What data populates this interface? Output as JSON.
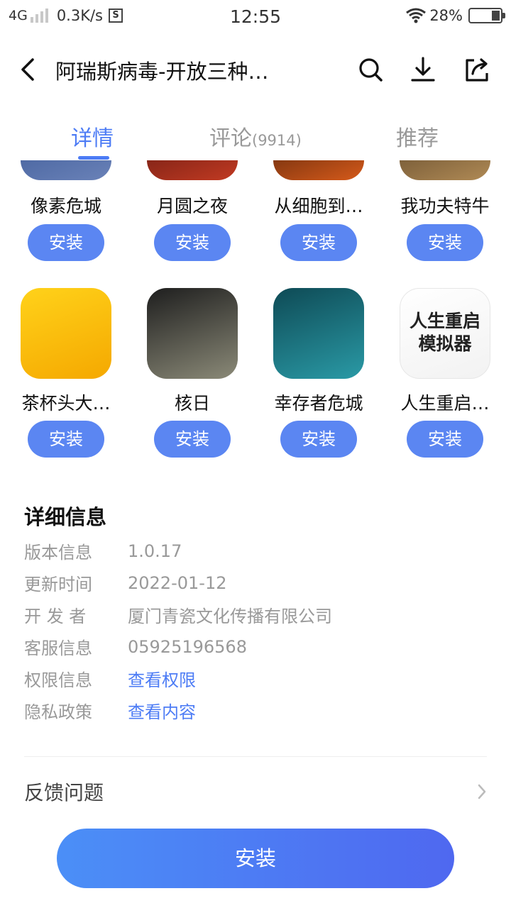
{
  "status_bar": {
    "network": "4G",
    "speed": "0.3K/s",
    "s_badge": "S",
    "time": "12:55",
    "battery": "28%",
    "battery_level": 0.28
  },
  "header": {
    "back_icon": "back-arrow-icon",
    "title": "阿瑞斯病毒-开放三种…",
    "actions": [
      "search-icon",
      "download-icon",
      "share-icon"
    ]
  },
  "tabs": [
    {
      "label": "详情",
      "count": ""
    },
    {
      "label": "评论",
      "count": "(9914)"
    },
    {
      "label": "推荐",
      "count": ""
    }
  ],
  "recommend": {
    "install_label": "安装",
    "rows": [
      [
        {
          "name": "像素危城",
          "colors": [
            "#2b4a8a",
            "#6a82b8"
          ]
        },
        {
          "name": "月圆之夜",
          "colors": [
            "#3a0b0b",
            "#c23a22"
          ]
        },
        {
          "name": "从细胞到…",
          "colors": [
            "#1a0b05",
            "#d65a1a"
          ]
        },
        {
          "name": "我功夫特牛",
          "colors": [
            "#3b2a18",
            "#b08a55"
          ]
        }
      ],
      [
        {
          "name": "茶杯头大…",
          "colors": [
            "#ffd21a",
            "#f5a800"
          ]
        },
        {
          "name": "核日",
          "colors": [
            "#1e1e1e",
            "#8b8a78"
          ]
        },
        {
          "name": "幸存者危城",
          "colors": [
            "#0e4a55",
            "#2a9aa6"
          ]
        },
        {
          "name": "人生重启…",
          "colors": [
            "#ffffff",
            "#f2f2f2"
          ],
          "logo_text": [
            "人生重启",
            "模拟器"
          ]
        }
      ]
    ]
  },
  "details": {
    "title": "详细信息",
    "rows": [
      {
        "label": "版本信息",
        "value": "1.0.17",
        "link": false
      },
      {
        "label": "更新时间",
        "value": "2022-01-12",
        "link": false
      },
      {
        "label": "开 发 者",
        "value": "厦门青瓷文化传播有限公司",
        "link": false
      },
      {
        "label": "客服信息",
        "value": "05925196568",
        "link": false
      },
      {
        "label": "权限信息",
        "value": "查看权限",
        "link": true
      },
      {
        "label": "隐私政策",
        "value": "查看内容",
        "link": true
      }
    ]
  },
  "feedback": {
    "label": "反馈问题",
    "icon": "chevron-right-icon"
  },
  "bottom": {
    "install_label": "安装"
  },
  "colors": {
    "accent": "#4d7cf5",
    "button": "#5b86f2"
  }
}
